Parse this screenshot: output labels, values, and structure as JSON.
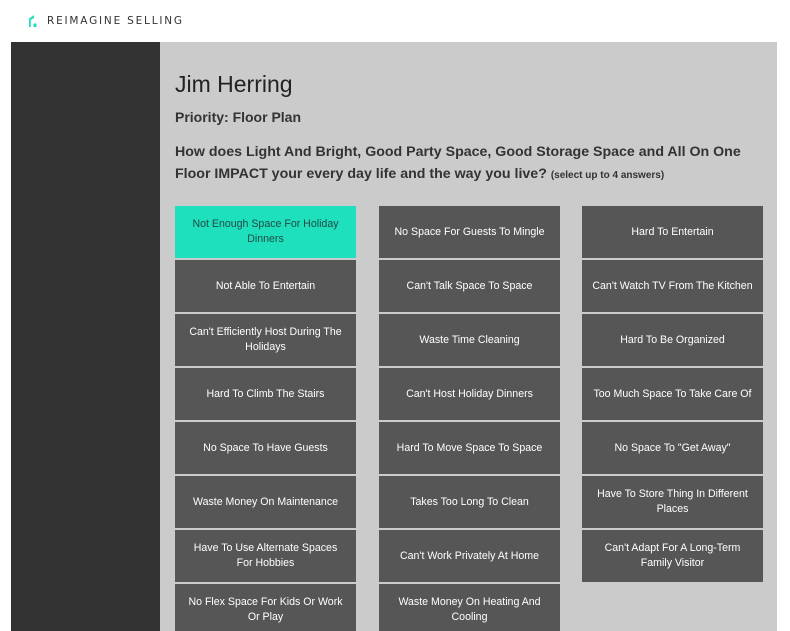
{
  "brand": {
    "name": "REIMAGINE SELLING",
    "accent": "#1fe0bd",
    "icon": "house-logo-icon"
  },
  "client": {
    "name": "Jim Herring"
  },
  "priority": {
    "label": "Priority: Floor Plan"
  },
  "question": {
    "text_before": "How does Light And Bright, Good Party Space, Good Storage Space and All On One Floor ",
    "emphasis": "IMPACT",
    "text_after": " your every day life and the way you live? ",
    "hint": "(select up to 4 answers)"
  },
  "options": {
    "col1": [
      {
        "label": "Not Enough Space For Holiday Dinners",
        "selected": true
      },
      {
        "label": "Not Able To Entertain",
        "selected": false
      },
      {
        "label": "Can't Efficiently Host During The Holidays",
        "selected": false
      },
      {
        "label": "Hard To Climb The Stairs",
        "selected": false
      },
      {
        "label": "No Space To Have Guests",
        "selected": false
      },
      {
        "label": "Waste Money On Maintenance",
        "selected": false
      },
      {
        "label": "Have To Use Alternate Spaces For Hobbies",
        "selected": false
      },
      {
        "label": "No Flex Space For Kids Or Work Or Play",
        "selected": false
      }
    ],
    "col2": [
      {
        "label": "No Space For Guests To Mingle",
        "selected": false
      },
      {
        "label": "Can't Talk Space To Space",
        "selected": false
      },
      {
        "label": "Waste Time Cleaning",
        "selected": false
      },
      {
        "label": "Can't Host Holiday Dinners",
        "selected": false
      },
      {
        "label": "Hard To Move Space To Space",
        "selected": false
      },
      {
        "label": "Takes Too Long To Clean",
        "selected": false
      },
      {
        "label": "Can't Work Privately At Home",
        "selected": false
      },
      {
        "label": "Waste Money On Heating And Cooling",
        "selected": false
      }
    ],
    "col3": [
      {
        "label": "Hard To Entertain",
        "selected": false
      },
      {
        "label": "Can't Watch TV From The Kitchen",
        "selected": false
      },
      {
        "label": "Hard To Be Organized",
        "selected": false
      },
      {
        "label": "Too Much Space To Take Care Of",
        "selected": false
      },
      {
        "label": "No Space To \"Get Away\"",
        "selected": false
      },
      {
        "label": "Have To Store Thing In Different Places",
        "selected": false
      },
      {
        "label": "Can't Adapt For A Long-Term Family Visitor",
        "selected": false
      }
    ]
  }
}
